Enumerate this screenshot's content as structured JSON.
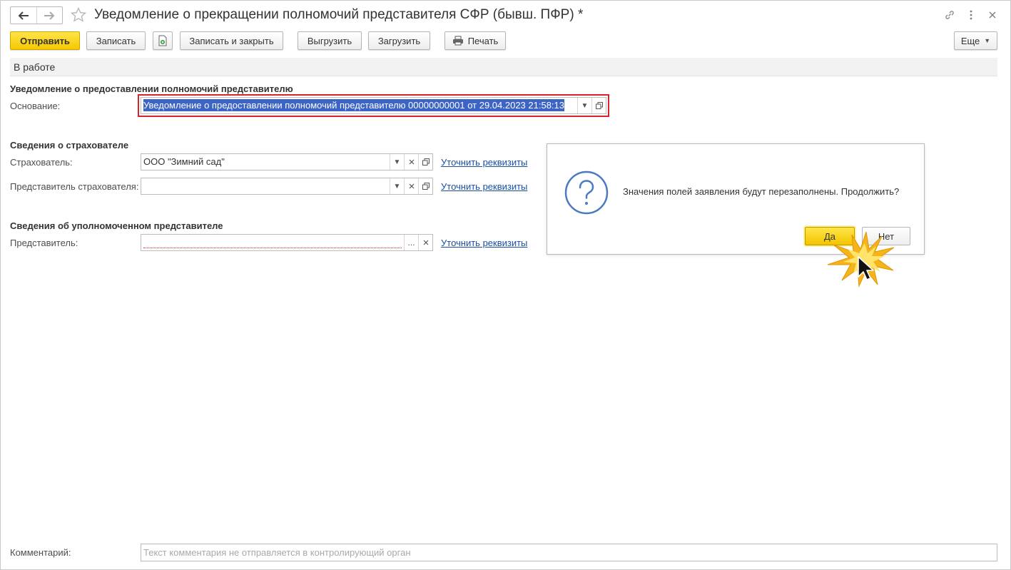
{
  "window": {
    "title": "Уведомление о прекращении полномочий представителя СФР (бывш. ПФР) *",
    "controls": [
      "link-icon",
      "more-icon",
      "close-icon"
    ]
  },
  "toolbar": {
    "send_label": "Отправить",
    "save_label": "Записать",
    "save_close_label": "Записать и закрыть",
    "export_label": "Выгрузить",
    "import_label": "Загрузить",
    "print_label": "Печать",
    "more_label": "Еще"
  },
  "status": {
    "text": "В работе"
  },
  "basis_section": {
    "title": "Уведомление о предоставлении полномочий представителю",
    "basis_label": "Основание:",
    "basis_value": "Уведомление о предоставлении полномочий представителю 00000000001 от 29.04.2023 21:58:13"
  },
  "insurer_section": {
    "title": "Сведения о страхователе",
    "insurer_label": "Страхователь:",
    "insurer_value": "ООО \"Зимний сад\"",
    "insurer_rep_label": "Представитель страхователя:",
    "insurer_rep_value": "",
    "clarify_link": "Уточнить реквизиты"
  },
  "representative_section": {
    "title": "Сведения об уполномоченном представителе",
    "rep_label": "Представитель:",
    "rep_value": "",
    "clarify_link": "Уточнить реквизиты"
  },
  "dialog": {
    "message": "Значения полей заявления будут перезаполнены. Продолжить?",
    "yes_label": "Да",
    "no_label": "Нет"
  },
  "comment": {
    "label": "Комментарий:",
    "placeholder": "Текст комментария не отправляется в контролирующий орган"
  },
  "colors": {
    "primary_button": "#f5c800",
    "link": "#1a4fa3",
    "highlight_frame": "#d9232a",
    "selection": "#3b64c6",
    "question_icon": "#4a7bc1"
  }
}
